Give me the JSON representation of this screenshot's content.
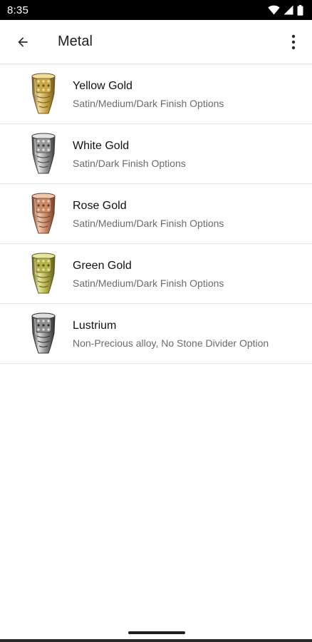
{
  "status_bar": {
    "time": "8:35",
    "icons": [
      "wifi-icon",
      "cellular-signal-icon",
      "battery-icon"
    ]
  },
  "app_bar": {
    "title": "Metal",
    "back_icon": "arrow-back-icon",
    "menu_icon": "more-vert-icon"
  },
  "metals": [
    {
      "title": "Yellow Gold",
      "subtitle": "Satin/Medium/Dark Finish Options",
      "icon": "ring-icon",
      "colors": {
        "light": "#f0dc9c",
        "mid": "#c9a84a",
        "dark": "#6e5520"
      }
    },
    {
      "title": "White Gold",
      "subtitle": "Satin/Dark Finish Options",
      "icon": "ring-icon",
      "colors": {
        "light": "#e4e4e4",
        "mid": "#9a9a9a",
        "dark": "#3c3c3c"
      }
    },
    {
      "title": "Rose Gold",
      "subtitle": "Satin/Medium/Dark Finish Options",
      "icon": "ring-icon",
      "colors": {
        "light": "#f0c8b0",
        "mid": "#c98a6a",
        "dark": "#6e3f2a"
      }
    },
    {
      "title": "Green Gold",
      "subtitle": "Satin/Medium/Dark Finish Options",
      "icon": "ring-icon",
      "colors": {
        "light": "#e6e6a2",
        "mid": "#b5b24e",
        "dark": "#5e5a1c"
      }
    },
    {
      "title": "Lustrium",
      "subtitle": "Non-Precious alloy, No Stone Divider Option",
      "icon": "ring-icon",
      "colors": {
        "light": "#dedede",
        "mid": "#8e8e8e",
        "dark": "#2e2e2e"
      }
    }
  ]
}
